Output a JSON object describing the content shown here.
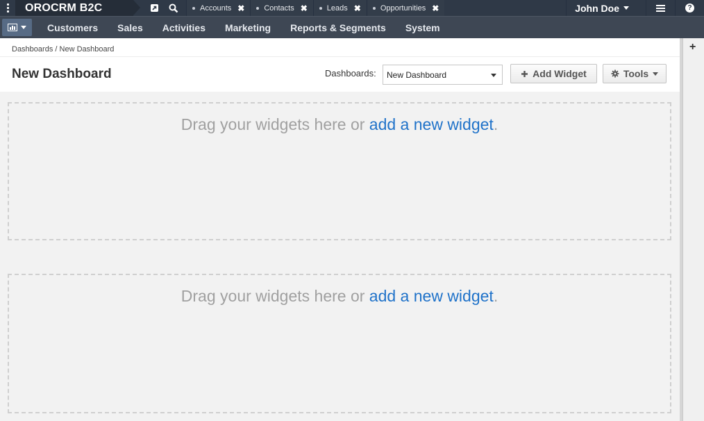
{
  "topbar": {
    "brand": "OROCRM B2C",
    "pinned_tabs": [
      {
        "label": "Accounts"
      },
      {
        "label": "Contacts"
      },
      {
        "label": "Leads"
      },
      {
        "label": "Opportunities"
      }
    ],
    "user_name": "John Doe",
    "help_glyph": "?"
  },
  "navbar": {
    "items": [
      "Customers",
      "Sales",
      "Activities",
      "Marketing",
      "Reports & Segments",
      "System"
    ]
  },
  "breadcrumb": {
    "root": "Dashboards",
    "separator": "/",
    "current": "New Dashboard"
  },
  "page": {
    "title": "New Dashboard",
    "dashboards_label": "Dashboards:",
    "dashboard_selected": "New Dashboard",
    "add_widget_label": "Add Widget",
    "tools_label": "Tools"
  },
  "dropzones": [
    {
      "text_before": "Drag your widgets here or ",
      "link": "add a new widget",
      "text_after": "."
    },
    {
      "text_before": "Drag your widgets here or ",
      "link": "add a new widget",
      "text_after": "."
    }
  ],
  "sidebar": {
    "add_glyph": "+"
  },
  "colors": {
    "topbar": "#2f3947",
    "navbar": "#3e4754",
    "link": "#1f72c9",
    "dashboard_button": "#576b85"
  }
}
